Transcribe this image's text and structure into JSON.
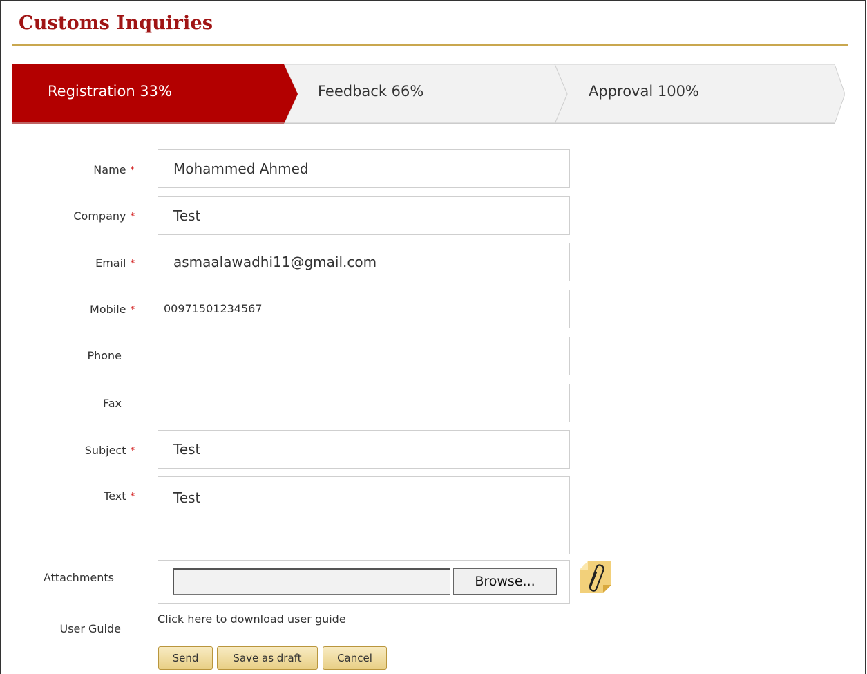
{
  "header": {
    "title": "Customs Inquiries"
  },
  "steps": [
    {
      "label": "Registration 33%",
      "active": true
    },
    {
      "label": "Feedback 66%",
      "active": false
    },
    {
      "label": "Approval 100%",
      "active": false
    }
  ],
  "colors": {
    "active_step": "#b30000",
    "title": "#a01414",
    "required": "#d01010",
    "button": "#e8cf85"
  },
  "form": {
    "name": {
      "label": "Name",
      "value": "Mohammed Ahmed",
      "required": true
    },
    "company": {
      "label": "Company",
      "value": "Test",
      "required": true
    },
    "email": {
      "label": "Email",
      "value": "asmaalawadhi11@gmail.com",
      "required": true
    },
    "mobile": {
      "label": "Mobile",
      "value": "00971501234567",
      "required": true
    },
    "phone": {
      "label": "Phone",
      "value": "",
      "required": false
    },
    "fax": {
      "label": "Fax",
      "value": "",
      "required": false
    },
    "subject": {
      "label": "Subject",
      "value": "Test",
      "required": true
    },
    "text": {
      "label": "Text",
      "value": "Test",
      "required": true
    },
    "attachments": {
      "label": "Attachments",
      "browse_label": "Browse...",
      "icon": "paperclip-icon"
    },
    "user_guide": {
      "label": "User Guide",
      "link_text": "Click here to download user guide"
    },
    "required_marker": "*"
  },
  "actions": {
    "send": "Send",
    "save_draft": "Save as draft",
    "cancel": "Cancel"
  }
}
